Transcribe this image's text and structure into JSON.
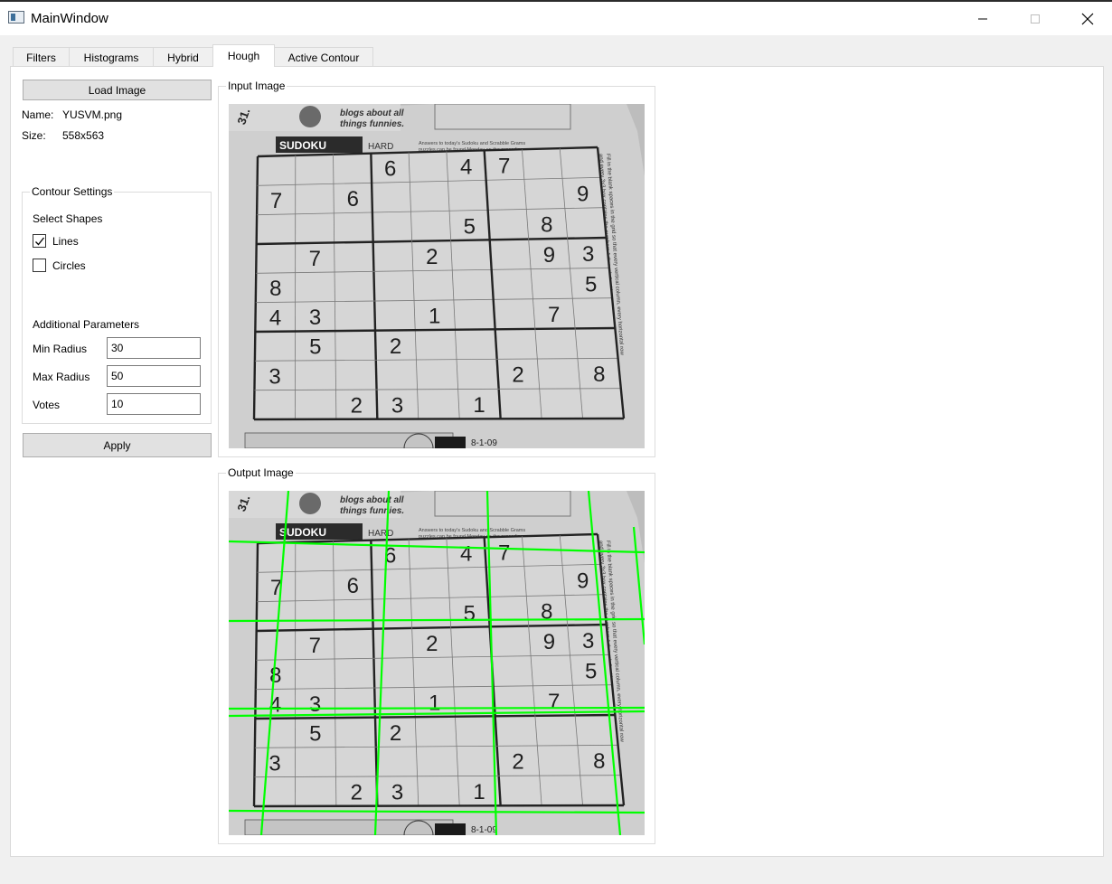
{
  "window": {
    "title": "MainWindow",
    "controls": {
      "minimize": "minimize-icon",
      "maximize": "maximize-icon",
      "close": "close-icon"
    }
  },
  "tabs": [
    {
      "label": "Filters"
    },
    {
      "label": "Histograms"
    },
    {
      "label": "Hybrid"
    },
    {
      "label": "Hough"
    },
    {
      "label": "Active Contour"
    }
  ],
  "active_tab": "Hough",
  "left_panel": {
    "load_button": "Load Image",
    "name_label": "Name:",
    "name_value": "YUSVM.png",
    "size_label": "Size:",
    "size_value": "558x563",
    "contour_settings": {
      "title": "Contour Settings",
      "select_shapes_label": "Select Shapes",
      "lines": {
        "label": "Lines",
        "checked": true
      },
      "circles": {
        "label": "Circles",
        "checked": false
      },
      "additional_parameters_label": "Additional Parameters",
      "min_radius": {
        "label": "Min Radius",
        "value": "30"
      },
      "max_radius": {
        "label": "Max Radius",
        "value": "50"
      },
      "votes": {
        "label": "Votes",
        "value": "10"
      }
    },
    "apply_button": "Apply"
  },
  "input_image": {
    "title": "Input Image",
    "header_text_1": "blogs about all",
    "header_text_2": "things funnies.",
    "page_number": "31.",
    "badge": "SUDOKU",
    "difficulty": "HARD",
    "note_1": "Answers to today's Sudoku and Scrabble Grams",
    "note_2": "puzzles can be found Monday on the preceding page.",
    "side_note_1": "Fill in the blank spaces in the grid so that every vertical column, every horizontal row",
    "side_note_2": "and every 3x3 box contains the numbers 1 through 9, without repeating any.",
    "footer_date": "8-1-09",
    "grid_rows": [
      [
        "",
        "",
        "",
        "6",
        "",
        "4",
        "7",
        "",
        ""
      ],
      [
        "7",
        "",
        "6",
        "",
        "",
        "",
        "",
        "",
        "9"
      ],
      [
        "",
        "",
        "",
        "",
        "",
        "5",
        "",
        "8",
        ""
      ],
      [
        "",
        "7",
        "",
        "",
        "2",
        "",
        "",
        "9",
        "3"
      ],
      [
        "8",
        "",
        "",
        "",
        "",
        "",
        "",
        "",
        "5"
      ],
      [
        "4",
        "3",
        "",
        "",
        "1",
        "",
        "",
        "7",
        ""
      ],
      [
        "",
        "5",
        "",
        "2",
        "",
        "",
        "",
        "",
        ""
      ],
      [
        "3",
        "",
        "",
        "",
        "",
        "",
        "2",
        "",
        "8"
      ],
      [
        "",
        "",
        "2",
        "3",
        "",
        "1",
        "",
        "",
        ""
      ]
    ],
    "line_color": "#00ff00"
  },
  "output_image": {
    "title": "Output Image",
    "detected_line_color": "#00ff00"
  }
}
